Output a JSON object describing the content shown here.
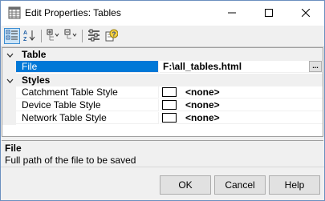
{
  "window": {
    "title": "Edit Properties: Tables",
    "icons": {
      "app": "grid-app-icon",
      "minimize": "minimize-icon",
      "maximize": "maximize-icon",
      "close": "close-icon"
    }
  },
  "toolbar": {
    "buttons": [
      {
        "name": "categorized-view",
        "icon": "categorized-icon",
        "active": true
      },
      {
        "name": "alphabetical-sort",
        "icon": "sort-az-icon",
        "active": false
      },
      {
        "name": "expand-all",
        "icon": "expand-all-icon",
        "active": false
      },
      {
        "name": "collapse-all",
        "icon": "collapse-all-icon",
        "active": false
      },
      {
        "name": "property-pages",
        "icon": "property-pages-icon",
        "active": false
      },
      {
        "name": "help",
        "icon": "help-icon",
        "active": false
      }
    ]
  },
  "grid": {
    "categories": [
      {
        "label": "Table"
      },
      {
        "label": "Styles"
      }
    ],
    "file_property": {
      "name": "File",
      "value": "F:\\all_tables.html",
      "browse": "..."
    },
    "style_properties": [
      {
        "name": "Catchment Table Style",
        "value": "<none>"
      },
      {
        "name": "Device Table Style",
        "value": "<none>"
      },
      {
        "name": "Network Table Style",
        "value": "<none>"
      }
    ]
  },
  "help": {
    "title": "File",
    "description": "Full path of the file to be saved"
  },
  "buttons": {
    "ok": "OK",
    "cancel": "Cancel",
    "help": "Help"
  },
  "colors": {
    "selection": "#0078d7",
    "accent_border": "#3f8fd2"
  }
}
